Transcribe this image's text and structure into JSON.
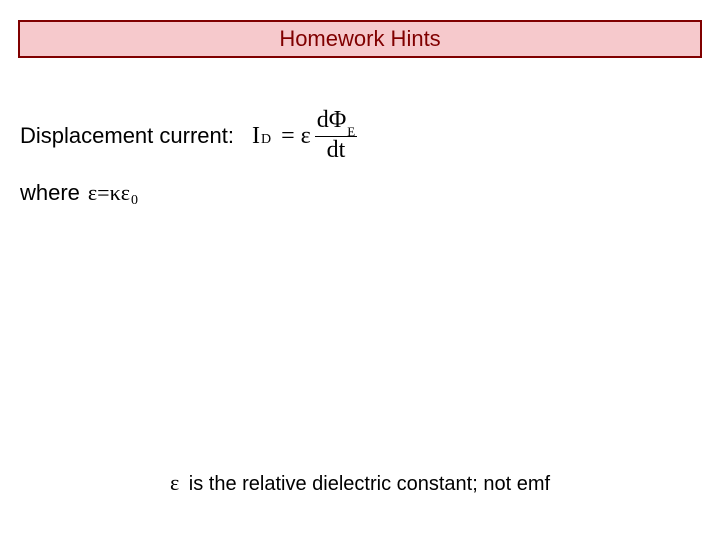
{
  "title": "Homework Hints",
  "displacement": {
    "label": "Displacement current:",
    "lhs_I": "I",
    "lhs_sub": "D",
    "equals": "=",
    "epsilon": "ε",
    "frac_num_d": "d",
    "frac_num_phi": "Φ",
    "frac_num_subE": "E",
    "frac_den": "dt"
  },
  "where": {
    "label": "where",
    "epsilon": "ε",
    "equals": " = ",
    "kappa": "κ",
    "epsilon0": "ε",
    "sub0": "0"
  },
  "footer": {
    "epsilon": "ε",
    "text": " is the relative dielectric constant; not emf"
  }
}
